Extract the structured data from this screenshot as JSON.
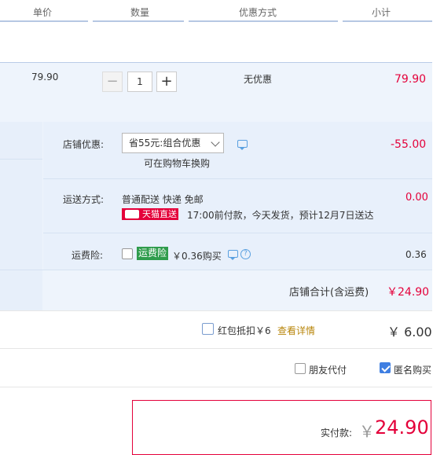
{
  "header": {
    "unit_price": "单价",
    "quantity": "数量",
    "discount_method": "优惠方式",
    "subtotal": "小计"
  },
  "item": {
    "unit_price": "79.90",
    "quantity": "1",
    "minus": "−",
    "plus": "+",
    "discount": "无优惠",
    "subtotal": "79.90"
  },
  "store": {
    "discount_label": "店铺优惠:",
    "discount_select": "省55元:组合优惠",
    "discount_hint": "可在购物车换购",
    "discount_amount": "-55.00",
    "shipping_label": "运送方式:",
    "shipping_method": "普通配送 快递 免邮",
    "tmall_badge": "天猫直送",
    "shipping_note": "17:00前付款，今天发货，预计12月7日送达",
    "shipping_amount": "0.00",
    "insurance_label": "运费险:",
    "insurance_badge": "运费险",
    "insurance_price": "￥0.36购买",
    "insurance_amount": "0.36",
    "total_label": "店铺合计(含运费)",
    "total_amount": "￥24.90"
  },
  "red_packet": {
    "label": "红包抵扣￥6",
    "link": "查看详情",
    "amount": "￥ 6.00"
  },
  "options": {
    "friend_pay": "朋友代付",
    "anonymous": "匿名购买"
  },
  "payment": {
    "label": "实付款:",
    "currency": "￥",
    "amount": "24.90"
  },
  "colors": {
    "accent_red": "#e4003a",
    "highlight_bg": "#eef4fc",
    "check_blue": "#3f7fe2",
    "insurance_green": "#2f9c4c"
  }
}
